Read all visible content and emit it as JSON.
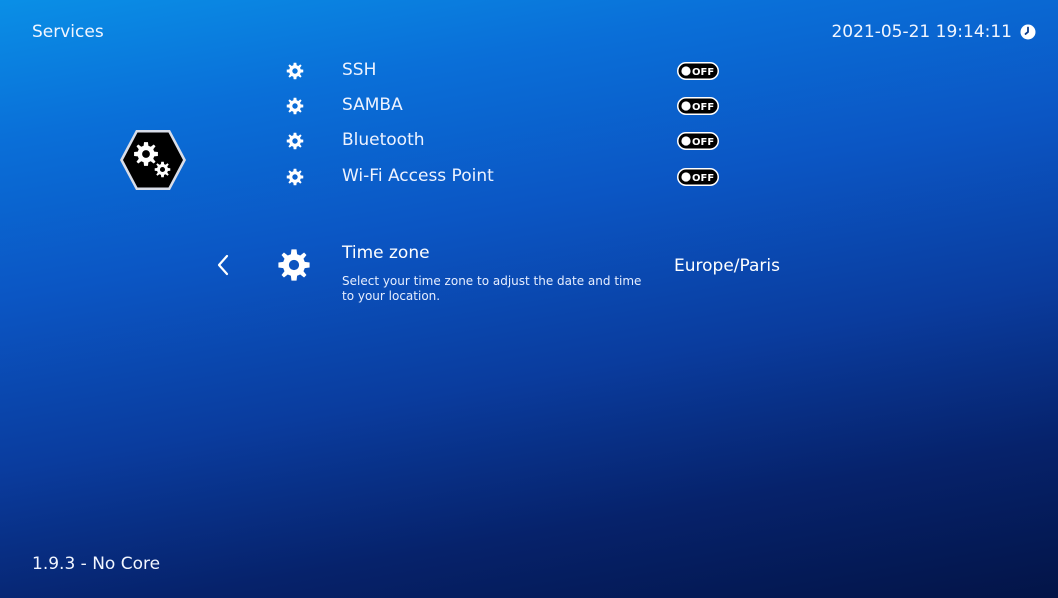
{
  "header": {
    "title": "Services",
    "datetime": "2021-05-21 19:14:11"
  },
  "section_icon": "system-gears-icon",
  "services": [
    {
      "label": "SSH",
      "state": "OFF",
      "icon": "gear-icon"
    },
    {
      "label": "SAMBA",
      "state": "OFF",
      "icon": "gear-icon"
    },
    {
      "label": "Bluetooth",
      "state": "OFF",
      "icon": "gear-icon"
    },
    {
      "label": "Wi-Fi Access Point",
      "state": "OFF",
      "icon": "gear-icon"
    }
  ],
  "timezone": {
    "title": "Time zone",
    "description": "Select your time zone to adjust the date and time to your location.",
    "value": "Europe/Paris",
    "icon": "gear-icon",
    "nav_icon": "chevron-left-icon"
  },
  "footer": {
    "version": "1.9.3 - No Core"
  },
  "colors": {
    "gradient_top": "#0a8fe6",
    "gradient_bottom": "#031447",
    "text": "#ffffff"
  }
}
